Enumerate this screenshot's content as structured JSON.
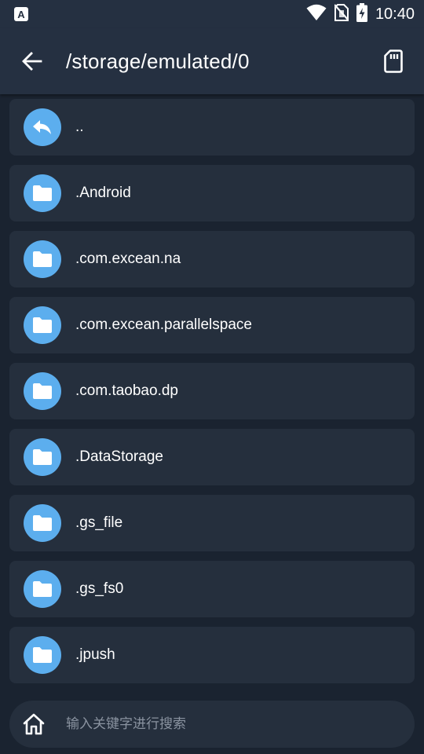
{
  "status_bar": {
    "app_badge": "A",
    "time": "10:40",
    "icons": [
      "app-notification-icon",
      "wifi-icon",
      "no-sim-icon",
      "battery-charging-icon"
    ]
  },
  "toolbar": {
    "path": "/storage/emulated/0",
    "back_icon": "arrow-left-icon",
    "sd_icon": "sd-card-icon"
  },
  "files": [
    {
      "name": "..",
      "icon": "parent-directory-icon"
    },
    {
      "name": ".Android",
      "icon": "folder-icon"
    },
    {
      "name": ".com.excean.na",
      "icon": "folder-icon"
    },
    {
      "name": ".com.excean.parallelspace",
      "icon": "folder-icon"
    },
    {
      "name": ".com.taobao.dp",
      "icon": "folder-icon"
    },
    {
      "name": ".DataStorage",
      "icon": "folder-icon"
    },
    {
      "name": ".gs_file",
      "icon": "folder-icon"
    },
    {
      "name": ".gs_fs0",
      "icon": "folder-icon"
    },
    {
      "name": ".jpush",
      "icon": "folder-icon"
    }
  ],
  "search": {
    "placeholder": "输入关键字进行搜索",
    "value": "",
    "home_icon": "home-icon"
  },
  "colors": {
    "background": "#1a2330",
    "bar": "#253041",
    "card": "#252f3d",
    "accent": "#5caeee"
  }
}
